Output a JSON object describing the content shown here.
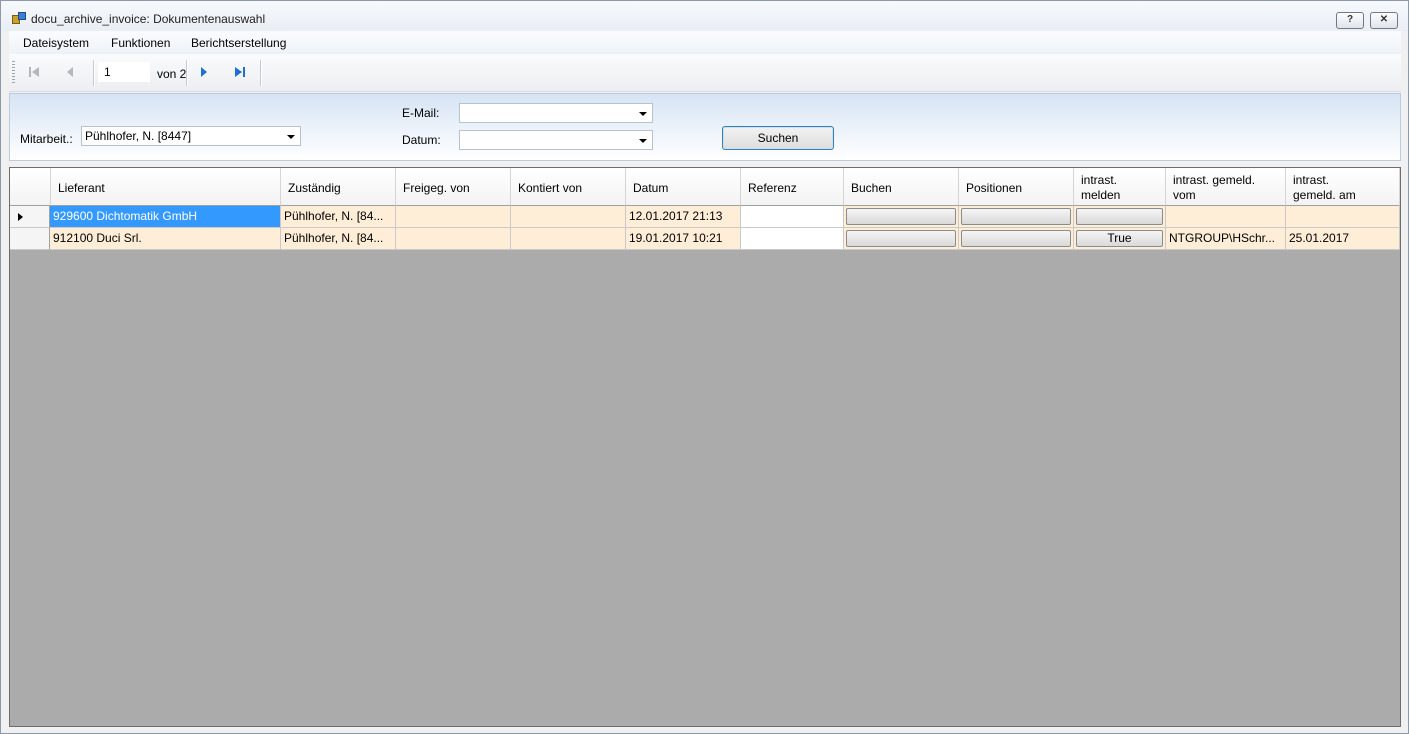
{
  "window": {
    "title": "docu_archive_invoice: Dokumentenauswahl",
    "help_label": "?",
    "close_label": "✕"
  },
  "menu": [
    {
      "label": "Dateisystem"
    },
    {
      "label": "Funktionen"
    },
    {
      "label": "Berichtserstellung"
    }
  ],
  "toolbar": {
    "page_value": "1",
    "page_of": "von 2"
  },
  "filter": {
    "mitarbeit_label": "Mitarbeit.:",
    "mitarbeit_value": "Pühlhofer, N. [8447]",
    "email_label": "E-Mail:",
    "email_value": "",
    "datum_label": "Datum:",
    "datum_value": "",
    "search_label": "Suchen"
  },
  "grid": {
    "columns": [
      {
        "l1": "Lieferant",
        "l2": ""
      },
      {
        "l1": "Zuständig",
        "l2": ""
      },
      {
        "l1": "Freigeg. von",
        "l2": ""
      },
      {
        "l1": "Kontiert von",
        "l2": ""
      },
      {
        "l1": "Datum",
        "l2": ""
      },
      {
        "l1": "Referenz",
        "l2": ""
      },
      {
        "l1": "Buchen",
        "l2": ""
      },
      {
        "l1": "Positionen",
        "l2": ""
      },
      {
        "l1": "intrast.",
        "l2": "melden"
      },
      {
        "l1": "intrast. gemeld.",
        "l2": "vom"
      },
      {
        "l1": "intrast.",
        "l2": "gemeld. am"
      }
    ],
    "rows": [
      {
        "lieferant": "929600 Dichtomatik GmbH",
        "zustaendig": "Pühlhofer, N. [84...",
        "freigeg": "",
        "kontiert": "",
        "datum": "12.01.2017 21:13",
        "referenz": "",
        "buchen": "",
        "positionen": "",
        "melden": "",
        "gemeld_vom": "",
        "gemeld_am": ""
      },
      {
        "lieferant": "912100 Duci Srl.",
        "zustaendig": "Pühlhofer, N. [84...",
        "freigeg": "",
        "kontiert": "",
        "datum": "19.01.2017 10:21",
        "referenz": "",
        "buchen": "",
        "positionen": "",
        "melden": "True",
        "gemeld_vom": "NTGROUP\\HSchr...",
        "gemeld_am": "25.01.2017"
      }
    ]
  }
}
